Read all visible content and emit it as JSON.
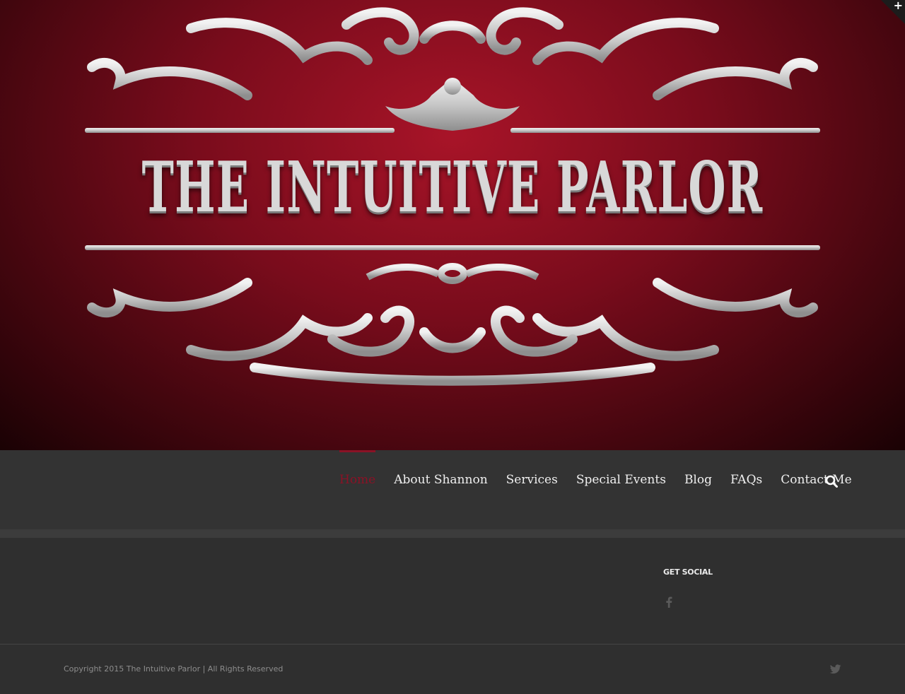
{
  "hero": {
    "logo_text": "THE INTUITIVE PARLOR",
    "colors": {
      "background": "#8a1226",
      "ornament": "#d0d0d0"
    }
  },
  "corner_toggle": {
    "icon": "plus-icon",
    "label": "+"
  },
  "nav": {
    "items": [
      {
        "label": "Home",
        "active": true
      },
      {
        "label": "About Shannon",
        "active": false
      },
      {
        "label": "Services",
        "active": false
      },
      {
        "label": "Special Events",
        "active": false
      },
      {
        "label": "Blog",
        "active": false
      },
      {
        "label": "FAQs",
        "active": false
      },
      {
        "label": "Contact Me",
        "active": false
      }
    ],
    "search_icon": "search-icon",
    "accent_color": "#8a1226"
  },
  "footer": {
    "widget_title": "GET SOCIAL",
    "social_icons": [
      "facebook-icon"
    ],
    "copyright": "Copyright 2015 The Intuitive Parlor | All Rights Reserved",
    "bottom_icons": [
      "twitter-icon"
    ]
  }
}
